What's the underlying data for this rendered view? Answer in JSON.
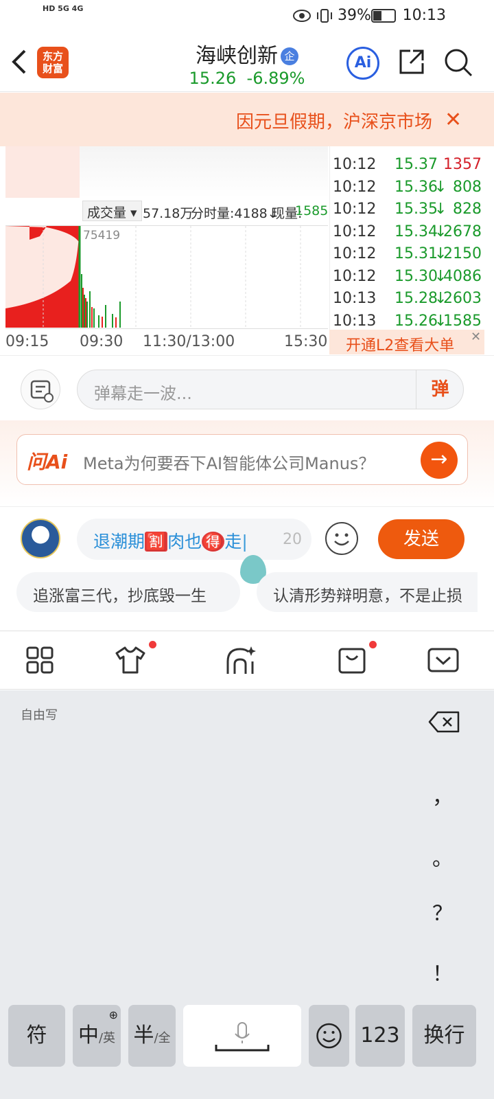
{
  "status": {
    "signal_text": "HD 5G 4G",
    "battery_pct": "39%",
    "time": "10:13"
  },
  "header": {
    "logo_line1": "东方",
    "logo_line2": "财富",
    "stock_name": "海峡创新",
    "badge": "企",
    "price": "15.26",
    "change": "-6.89%",
    "ai_label": "Ai"
  },
  "notice": {
    "text": "因元旦假期，沪深京市场",
    "close": "✕"
  },
  "chart": {
    "volume_selector": "成交量",
    "total_volume": "57.18万",
    "minute_volume": "分时量:4188↓",
    "now_label": "现量:",
    "now_value": "1585",
    "peak_label": "75419",
    "time_labels": [
      "09:15",
      "09:30",
      "11:30/13:00",
      "15:30"
    ]
  },
  "ticks": [
    {
      "time": "10:12",
      "price": "15.37",
      "vol": "1357",
      "dir": ""
    },
    {
      "time": "10:12",
      "price": "15.36",
      "vol": "808",
      "dir": "↓"
    },
    {
      "time": "10:12",
      "price": "15.35",
      "vol": "828",
      "dir": "↓"
    },
    {
      "time": "10:12",
      "price": "15.34",
      "vol": "2678",
      "dir": "↓"
    },
    {
      "time": "10:12",
      "price": "15.31",
      "vol": "2150",
      "dir": "↓"
    },
    {
      "time": "10:12",
      "price": "15.30",
      "vol": "4086",
      "dir": "↓"
    },
    {
      "time": "10:13",
      "price": "15.28",
      "vol": "2603",
      "dir": "↓"
    },
    {
      "time": "10:13",
      "price": "15.26",
      "vol": "1585",
      "dir": "↓"
    }
  ],
  "l2_banner": "开通L2查看大单",
  "danmaku": {
    "placeholder": "弹幕走一波...",
    "button": "弹"
  },
  "ask_ai": {
    "label": "问Ai",
    "question": "Meta为何要吞下AI智能体公司Manus？",
    "go": "→"
  },
  "compose": {
    "text_part1": "退潮期",
    "emoji1": "🈹",
    "text_part2": "肉也",
    "emoji2": "🉐",
    "text_part3": "走",
    "remaining": "20",
    "send": "发送",
    "suggestions": [
      "追涨富三代，抄底毁一生",
      "认清形势辩明意，不是止损"
    ]
  },
  "keyboard": {
    "hint": "自由写",
    "punctuation": [
      "，",
      "。",
      "？",
      "！"
    ],
    "keys": {
      "symbol": "符",
      "lang_main": "中",
      "lang_alt": "/英",
      "width_main": "半",
      "width_alt": "/全",
      "numbers": "123",
      "newline": "换行"
    }
  }
}
